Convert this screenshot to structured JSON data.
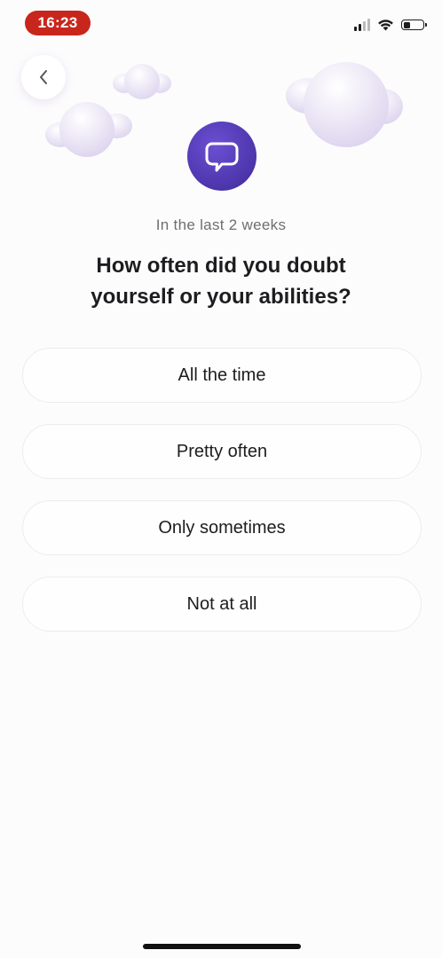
{
  "status_bar": {
    "time": "16:23",
    "icons": [
      "signal-icon",
      "wifi-icon",
      "battery-icon"
    ],
    "battery_level": 0.35,
    "time_pill_color": "#c8261c"
  },
  "header": {
    "back_icon": "chevron-left-icon",
    "logo_icon": "speech-bubble-icon",
    "logo_color": "#5b3fc4"
  },
  "question": {
    "subtitle": "In the last 2 weeks",
    "line1": "How often did you doubt",
    "line2": "yourself or your abilities?"
  },
  "options": [
    {
      "label": "All the time"
    },
    {
      "label": "Pretty often"
    },
    {
      "label": "Only sometimes"
    },
    {
      "label": "Not at all"
    }
  ]
}
